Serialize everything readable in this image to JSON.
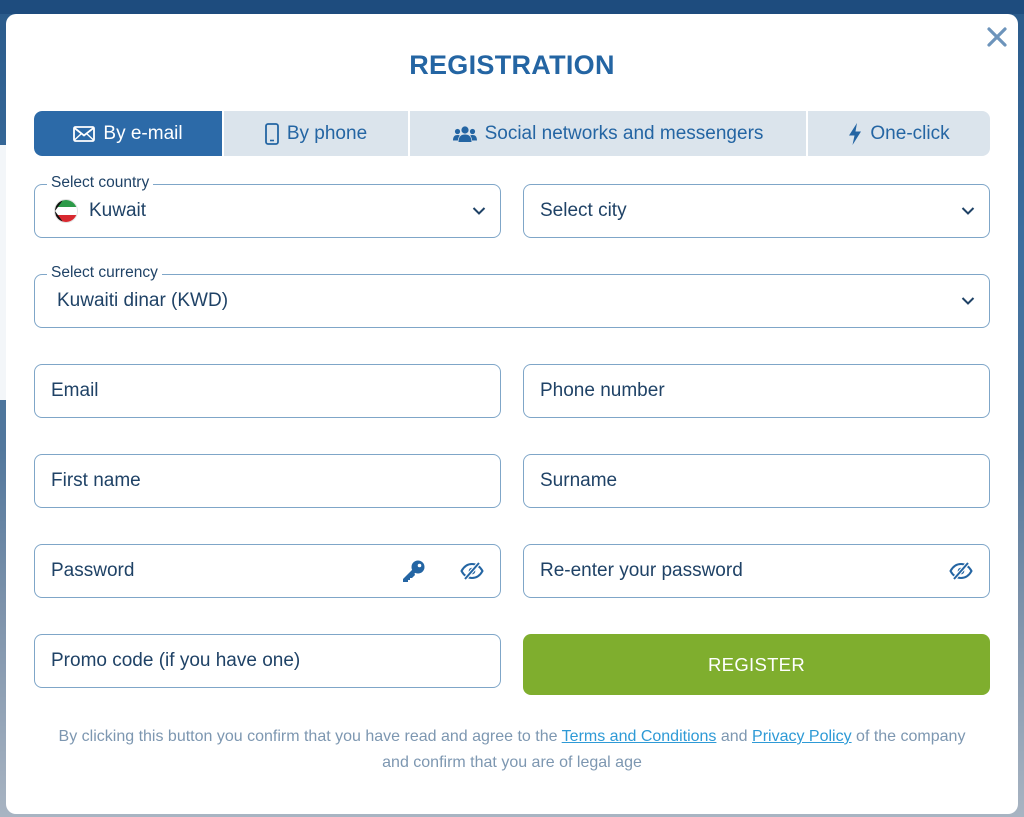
{
  "modal": {
    "title": "REGISTRATION"
  },
  "tabs": [
    {
      "label": "By e-mail",
      "icon": "envelope-icon",
      "active": true
    },
    {
      "label": "By phone",
      "icon": "phone-icon",
      "active": false
    },
    {
      "label": "Social networks and messengers",
      "icon": "users-icon",
      "active": false
    },
    {
      "label": "One-click",
      "icon": "lightning-icon",
      "active": false
    }
  ],
  "form": {
    "country": {
      "legend": "Select country",
      "value": "Kuwait",
      "flag": "kuwait-flag-icon"
    },
    "city": {
      "placeholder": "Select city"
    },
    "currency": {
      "legend": "Select currency",
      "value": "Kuwaiti dinar (KWD)"
    },
    "email": {
      "placeholder": "Email"
    },
    "phone": {
      "placeholder": "Phone number"
    },
    "first_name": {
      "placeholder": "First name"
    },
    "surname": {
      "placeholder": "Surname"
    },
    "password": {
      "placeholder": "Password"
    },
    "password_confirm": {
      "placeholder": "Re-enter your password"
    },
    "promo": {
      "placeholder": "Promo code (if you have one)"
    },
    "register_label": "REGISTER"
  },
  "terms": {
    "before": "By clicking this button you confirm that you have read and agree to the ",
    "terms_link": "Terms and Conditions",
    "middle": " and ",
    "privacy_link": "Privacy Policy",
    "after": " of the company",
    "line2": "and confirm that you are of legal age"
  },
  "colors": {
    "primary": "#2465a3",
    "tab_active": "#2c6aa8",
    "tab_bg": "#dbe4ec",
    "border": "#7fa6c8",
    "register": "#7fae2e",
    "link": "#2e9ad6"
  }
}
